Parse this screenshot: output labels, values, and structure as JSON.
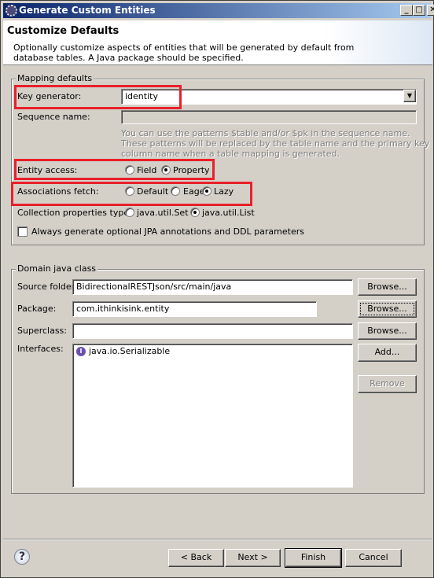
{
  "window": {
    "title": "Generate Custom Entities",
    "icon": "eclipse-gear-icon"
  },
  "header": {
    "title": "Customize Defaults",
    "description_line1": "Optionally customize aspects of entities that will be generated by default from",
    "description_line2": "database tables. A Java package should be specified."
  },
  "mapping": {
    "legend": "Mapping defaults",
    "key_generator_label": "Key generator:",
    "key_generator_value": "identity",
    "sequence_name_label": "Sequence name:",
    "sequence_name_value": "",
    "hint1": "You can use the patterns $table and/or $pk in the sequence name.",
    "hint2": "These patterns will be replaced by the table name and the primary key",
    "hint3": "column name when a table mapping is generated.",
    "entity_access_label": "Entity access:",
    "entity_access_options": [
      "Field",
      "Property"
    ],
    "entity_access_selected": "Property",
    "fetch_label": "Associations fetch:",
    "fetch_options": [
      "Default",
      "Eager",
      "Lazy"
    ],
    "fetch_selected": "Lazy",
    "collection_label": "Collection properties type:",
    "collection_options": [
      "java.util.Set",
      "java.util.List"
    ],
    "collection_selected": "java.util.List",
    "checkbox_label": "Always generate optional JPA annotations and DDL parameters",
    "checkbox_checked": false
  },
  "domain": {
    "legend": "Domain java class",
    "source_folder_label": "Source folder:",
    "source_folder_value": "BidirectionalRESTJson/src/main/java",
    "package_label": "Package:",
    "package_value": "com.ithinkisink.entity",
    "superclass_label": "Superclass:",
    "superclass_value": "",
    "interfaces_label": "Interfaces:",
    "interfaces": [
      "java.io.Serializable"
    ],
    "browse": "Browse...",
    "add": "Add...",
    "remove": "Remove"
  },
  "footer": {
    "back": "< Back",
    "next": "Next >",
    "finish": "Finish",
    "cancel": "Cancel"
  },
  "colors": {
    "highlight_box": "#e8202a",
    "titlebar_start": "#0a246a",
    "titlebar_end": "#a6caf0"
  }
}
